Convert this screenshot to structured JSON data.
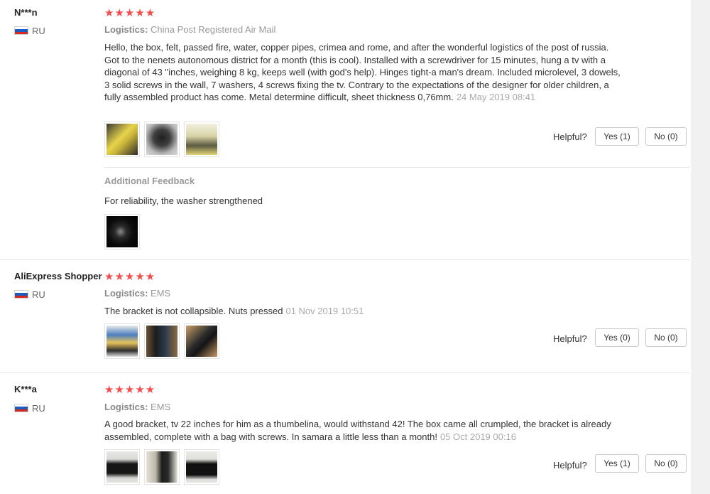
{
  "reviews": [
    {
      "user": "N***n",
      "country": "RU",
      "stars": "★★★★★",
      "logistics_label": "Logistics:",
      "logistics_value": "China Post Registered Air Mail",
      "text": "Hello, the box, felt, passed fire, water, copper pipes, crimea and rome, and after the wonderful logistics of the post of russia. Got to the nenets autonomous district for a month (this is cool). Installed with a screwdriver for 15 minutes, hung a tv with a diagonal of 43 ''inches, weighing 8 kg, keeps well (with god's help). Hinges tight-a man's dream. Included microlevel, 3 dowels, 3 solid screws in the wall, 7 washers, 4 screws fixing the tv. Contrary to the expectations of the designer for older children, a fully assembled product has come. Metal determine difficult, sheet thickness 0,76mm.",
      "date": "24 May 2019 08:41",
      "helpful_label": "Helpful?",
      "yes_label": "Yes (1)",
      "no_label": "No (0)",
      "additional_title": "Additional Feedback",
      "additional_text": "For reliability, the washer strengthened"
    },
    {
      "user": "AliExpress Shopper",
      "country": "RU",
      "stars": "★★★★★",
      "logistics_label": "Logistics:",
      "logistics_value": "EMS",
      "text": "The bracket is not collapsible. Nuts pressed",
      "date": "01 Nov 2019 10:51",
      "helpful_label": "Helpful?",
      "yes_label": "Yes (0)",
      "no_label": "No (0)"
    },
    {
      "user": "K***a",
      "country": "RU",
      "stars": "★★★★★",
      "logistics_label": "Logistics:",
      "logistics_value": "EMS",
      "text": "A good bracket, tv 22 inches for him as a thumbelina, would withstand 42! The box came all crumpled, the bracket is already assembled, complete with a bag with screws. In samara a little less than a month!",
      "date": "05 Oct 2019 00:16",
      "helpful_label": "Helpful?",
      "yes_label": "Yes (1)",
      "no_label": "No (0)"
    }
  ],
  "colors": {
    "star": "#f44b4b",
    "flag_white": "#ffffff",
    "flag_blue": "#1f5bbf",
    "flag_red": "#d52b1e"
  }
}
